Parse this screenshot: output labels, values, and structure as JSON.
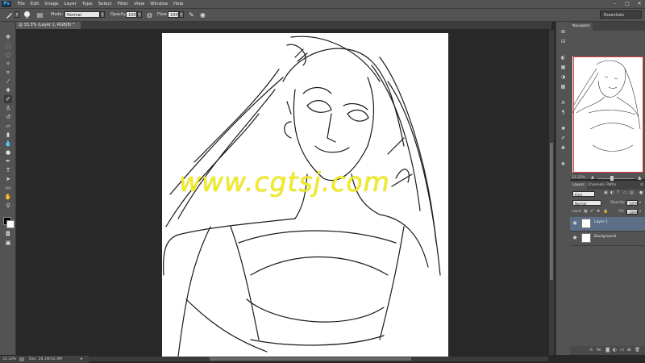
{
  "app": {
    "logo": "Ps"
  },
  "menu": [
    "File",
    "Edit",
    "Image",
    "Layer",
    "Type",
    "Select",
    "Filter",
    "View",
    "Window",
    "Help"
  ],
  "window_controls": {
    "minimize": "–",
    "maximize": "□",
    "close": "✕"
  },
  "options_bar": {
    "brush_size": "19",
    "mode_label": "Mode:",
    "mode_value": "Normal",
    "opacity_label": "Opacity:",
    "opacity_value": "100%",
    "flow_label": "Flow:",
    "flow_value": "100%"
  },
  "workspace": {
    "value": "Essentials"
  },
  "document_tab": {
    "label": "@ 33.3% (Layer 1, RGB/8) *"
  },
  "canvas": {
    "watermark": "www.cgtsj.com"
  },
  "status_bar": {
    "zoom": "33.33%",
    "doc_info": "Doc: 28.1M/32.9M"
  },
  "navigator": {
    "tab_label": "Navigator",
    "zoom": "33.33%"
  },
  "layers_panel": {
    "tabs": [
      "Layers",
      "Channels",
      "Paths"
    ],
    "filter_kind": "Kind",
    "blend_mode": "Normal",
    "opacity_label": "Opacity:",
    "opacity_value": "100%",
    "lock_label": "Lock:",
    "fill_label": "Fill:",
    "fill_value": "100%",
    "layers": [
      {
        "name": "Layer 1",
        "selected": true
      },
      {
        "name": "Background",
        "selected": false
      }
    ]
  },
  "colors": {
    "accent": "#e43a3a",
    "watermark": "#f1ec23",
    "chrome": "#535353",
    "pasteboard": "#282828",
    "selection": "#5d6f88"
  },
  "icons": {
    "tools": [
      "move-icon",
      "marquee-icon",
      "lasso-icon",
      "quick-select-icon",
      "crop-icon",
      "eyedropper-icon",
      "healing-icon",
      "brush-icon",
      "clone-stamp-icon",
      "history-brush-icon",
      "eraser-icon",
      "gradient-icon",
      "blur-icon",
      "dodge-icon",
      "pen-icon",
      "type-icon",
      "path-select-icon",
      "shape-icon",
      "hand-icon",
      "zoom-icon"
    ]
  }
}
